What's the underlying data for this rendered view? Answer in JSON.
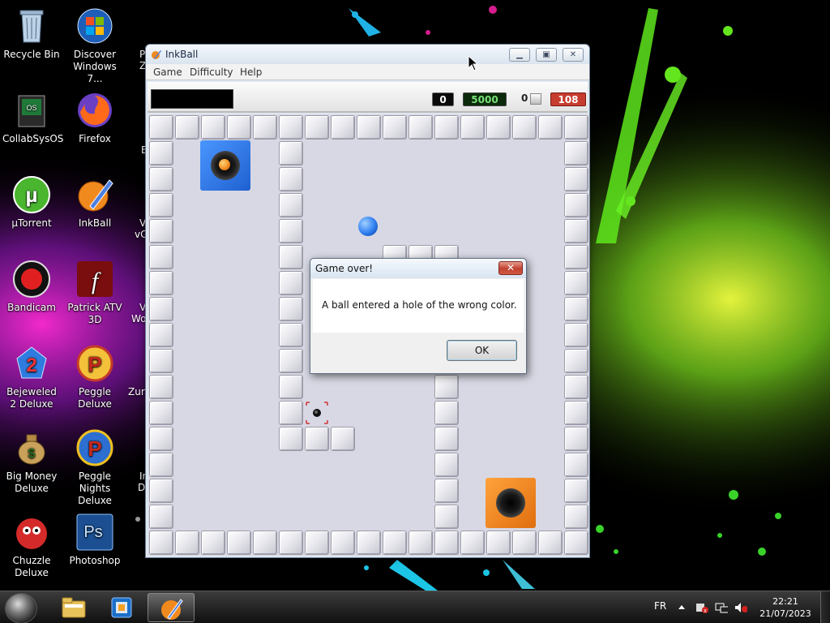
{
  "desktop": {
    "icons": [
      {
        "label": "Recycle Bin",
        "icon": "recycle-bin-icon"
      },
      {
        "label": "Discover Windows 7...",
        "icon": "windows-logo-icon"
      },
      {
        "label": "CollabSysOS",
        "icon": "collabsysos-icon"
      },
      {
        "label": "Firefox",
        "icon": "firefox-icon"
      },
      {
        "label": "µTorrent",
        "icon": "utorrent-icon"
      },
      {
        "label": "InkBall",
        "icon": "inkball-icon"
      },
      {
        "label": "Bandicam",
        "icon": "bandicam-icon"
      },
      {
        "label": "Patrick ATV 3D",
        "icon": "flash-icon"
      },
      {
        "label": "Bejeweled 2 Deluxe",
        "icon": "bejeweled-icon"
      },
      {
        "label": "Peggle Deluxe",
        "icon": "peggle-icon"
      },
      {
        "label": "Big Money Deluxe",
        "icon": "money-bag-icon"
      },
      {
        "label": "Peggle Nights Deluxe",
        "icon": "peggle-nights-icon"
      },
      {
        "label": "Chuzzle Deluxe",
        "icon": "chuzzle-icon"
      },
      {
        "label": "Photoshop",
        "icon": "photoshop-icon"
      }
    ],
    "partial_labels": [
      "P",
      "Z",
      "E",
      "V",
      "vC",
      "V",
      "Wo",
      "Zur",
      "In",
      "D"
    ]
  },
  "inkball": {
    "title": "InkBall",
    "menu": [
      "Game",
      "Difficulty",
      "Help"
    ],
    "scores": {
      "counter": "0",
      "score": "5000",
      "small_count": "0",
      "timer": "108"
    },
    "colors": {
      "counter_bg": "#0a0a0a",
      "score_bg": "#0b2a0b",
      "score_text": "#78e078",
      "timer_bg": "#c63c2e",
      "blue_hole": "#2f7ef0",
      "orange_hole": "#f08a1e",
      "board_bg": "#d8d8e4"
    }
  },
  "dialog": {
    "title": "Game over!",
    "message": "A ball entered a hole of the wrong color.",
    "ok_label": "OK",
    "close_symbol": "✕"
  },
  "taskbar": {
    "language": "FR",
    "time": "22:21",
    "date": "21/07/2023",
    "pinned": [
      "windows-explorer-icon",
      "virtualbox-icon",
      "inkball-icon"
    ]
  }
}
